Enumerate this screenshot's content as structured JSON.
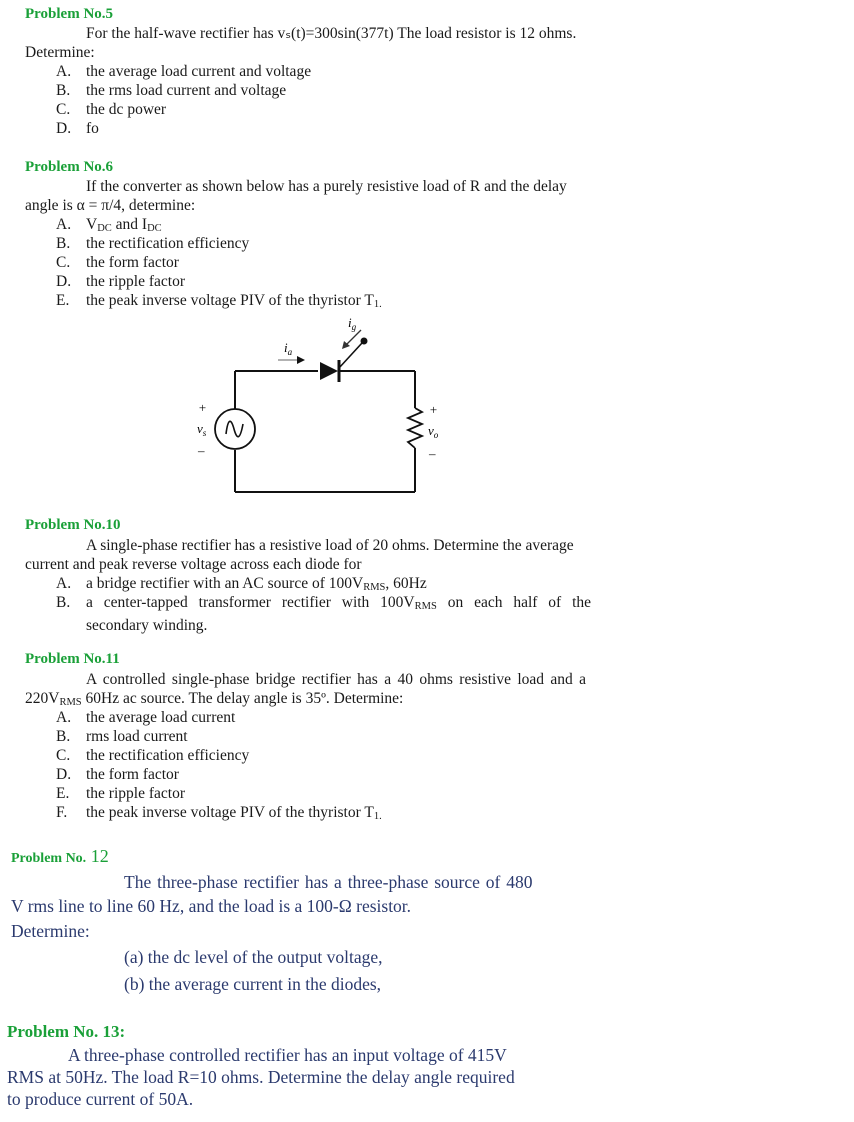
{
  "problem5": {
    "title": "Problem No.5",
    "intro_line1": "For the half-wave rectifier has vₛ(t)=300sin(377t) The load resistor is 12 ohms.",
    "intro_line2": "Determine:",
    "items": [
      {
        "label": "A.",
        "text": "the average load current and voltage"
      },
      {
        "label": "B.",
        "text": "the rms load current and voltage"
      },
      {
        "label": "C.",
        "text": "the dc power"
      },
      {
        "label": "D.",
        "text": "fo"
      }
    ]
  },
  "problem6": {
    "title": "Problem No.6",
    "intro_line1": "If the converter as shown below has a purely resistive load of R and the delay",
    "intro_line2": "angle is α = π/4, determine:",
    "items": [
      {
        "label": "A.",
        "text_main1": "V",
        "sub1": "DC",
        "text_mid": " and I",
        "sub2": "DC"
      },
      {
        "label": "B.",
        "text": "the rectification efficiency"
      },
      {
        "label": "C.",
        "text": "the form factor"
      },
      {
        "label": "D.",
        "text": "the ripple factor"
      },
      {
        "label": "E.",
        "text": "the peak inverse voltage PIV of the thyristor T",
        "sub": "1."
      }
    ],
    "circuit": {
      "source_label": "v",
      "source_sub": "s",
      "output_label": "v",
      "output_sub": "o",
      "anode_current_label": "i",
      "anode_current_sub": "a",
      "gate_current_label": "i",
      "gate_current_sub": "g",
      "plus": "+",
      "minus": "–"
    }
  },
  "problem10": {
    "title": "Problem No.10",
    "intro_line1": "A single-phase rectifier has a resistive load of 20 ohms. Determine the average",
    "intro_line2": "current and peak reverse voltage across each diode for",
    "items": [
      {
        "label": "A.",
        "pre": "a bridge rectifier with an AC source of 100V",
        "sub": "RMS",
        "post": ", 60Hz"
      },
      {
        "label": "B.",
        "pre": "a center-tapped transformer rectifier with 100V",
        "sub": "RMS",
        "post": " on each half of the",
        "cont": "secondary winding."
      }
    ]
  },
  "problem11": {
    "title": "Problem No.11",
    "intro_line1": "A controlled single-phase bridge rectifier has a 40 ohms resistive load and a",
    "intro_line2_pre": "220V",
    "intro_line2_sub": "RMS",
    "intro_line2_post": " 60Hz ac source. The delay angle is 35º. Determine:",
    "items": [
      {
        "label": "A.",
        "text": "the average load current"
      },
      {
        "label": "B.",
        "text": "rms load current"
      },
      {
        "label": "C.",
        "text": "the rectification efficiency"
      },
      {
        "label": "D.",
        "text": "the form factor"
      },
      {
        "label": "E.",
        "text": "the ripple factor"
      },
      {
        "label": "F.",
        "text": "the peak inverse voltage PIV of the thyristor T",
        "sub": "1."
      }
    ]
  },
  "problem12": {
    "title_prefix": "Problem No.",
    "title_number": " 12",
    "intro_line1": "The three-phase rectifier has a three-phase source of 480",
    "intro_line2": "V rms line to line 60 Hz, and the load is a 100-Ω resistor.",
    "intro_line3": "Determine:",
    "items": [
      "(a) the dc level of the output voltage,",
      "(b) the average current in the diodes,"
    ]
  },
  "problem13": {
    "title": "Problem No. 13:",
    "lines": [
      "A three-phase controlled rectifier has an input voltage of 415V",
      "RMS at 50Hz. The load R=10 ohms. Determine the delay angle required",
      "to produce current of 50A."
    ]
  },
  "colors": {
    "heading": "#1aa038",
    "body_text": "#1a1a1a",
    "navy_text": "#2b3a6e"
  }
}
